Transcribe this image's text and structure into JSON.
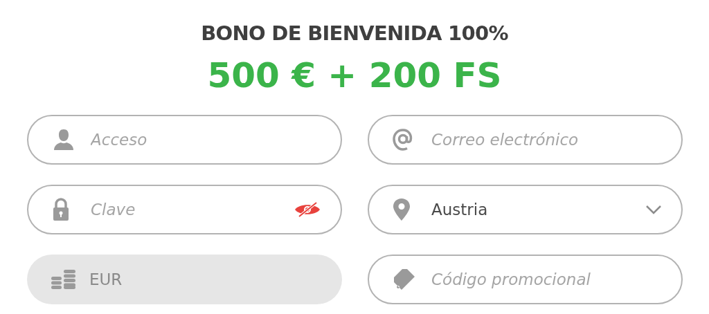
{
  "header": {
    "title": "BONO DE BIENVENIDA 100%",
    "headline": "500 € + 200 FS"
  },
  "fields": [
    {
      "kind": "login",
      "placeholder": "Acceso",
      "disabled": false
    },
    {
      "kind": "email",
      "placeholder": "Correo electrónico",
      "disabled": false
    },
    {
      "kind": "password",
      "placeholder": "Clave",
      "disabled": false
    },
    {
      "kind": "country",
      "value": "Austria",
      "disabled": false
    },
    {
      "kind": "currency",
      "value": "EUR",
      "disabled": true
    },
    {
      "kind": "promo",
      "placeholder": "Código promocional",
      "disabled": false
    }
  ]
}
